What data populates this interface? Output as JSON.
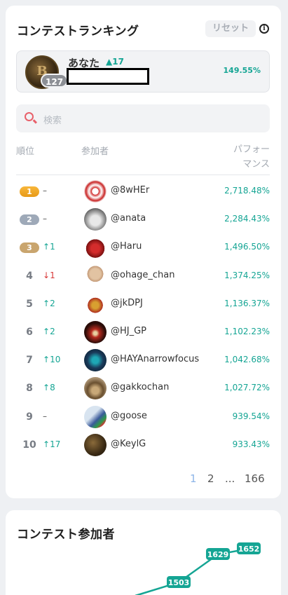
{
  "ranking": {
    "title": "コンテストランキング",
    "reset_label": "リセット",
    "you": {
      "name": "あなた",
      "rank": "127",
      "change": "17",
      "performance": "149.55%"
    },
    "search_placeholder": "検索",
    "columns": {
      "rank": "順位",
      "user": "参加者",
      "performance_line1": "パフォー",
      "performance_line2": "マンス"
    },
    "rows": [
      {
        "rank": "1",
        "change": "–",
        "dir": "none",
        "user": "@8wHEr",
        "perf": "2,718.48%"
      },
      {
        "rank": "2",
        "change": "–",
        "dir": "none",
        "user": "@anata",
        "perf": "2,284.43%"
      },
      {
        "rank": "3",
        "change": "1",
        "dir": "up",
        "user": "@Haru",
        "perf": "1,496.50%"
      },
      {
        "rank": "4",
        "change": "1",
        "dir": "down",
        "user": "@ohage_chan",
        "perf": "1,374.25%"
      },
      {
        "rank": "5",
        "change": "2",
        "dir": "up",
        "user": "@jkDPJ",
        "perf": "1,136.37%"
      },
      {
        "rank": "6",
        "change": "2",
        "dir": "up",
        "user": "@HJ_GP",
        "perf": "1,102.23%"
      },
      {
        "rank": "7",
        "change": "10",
        "dir": "up",
        "user": "@HAYAnarrowfocus",
        "perf": "1,042.68%"
      },
      {
        "rank": "8",
        "change": "8",
        "dir": "up",
        "user": "@gakkochan",
        "perf": "1,027.72%"
      },
      {
        "rank": "9",
        "change": "–",
        "dir": "none",
        "user": "@goose",
        "perf": "939.54%"
      },
      {
        "rank": "10",
        "change": "17",
        "dir": "up",
        "user": "@KeylG",
        "perf": "933.43%"
      }
    ],
    "pagination": {
      "pages": [
        "1",
        "2",
        "...",
        "166"
      ],
      "current": "1"
    }
  },
  "participants": {
    "title": "コンテスト参加者",
    "labels": [
      "1503",
      "1629",
      "1652"
    ]
  },
  "colors": {
    "accent": "#15a594",
    "down": "#d83838"
  }
}
